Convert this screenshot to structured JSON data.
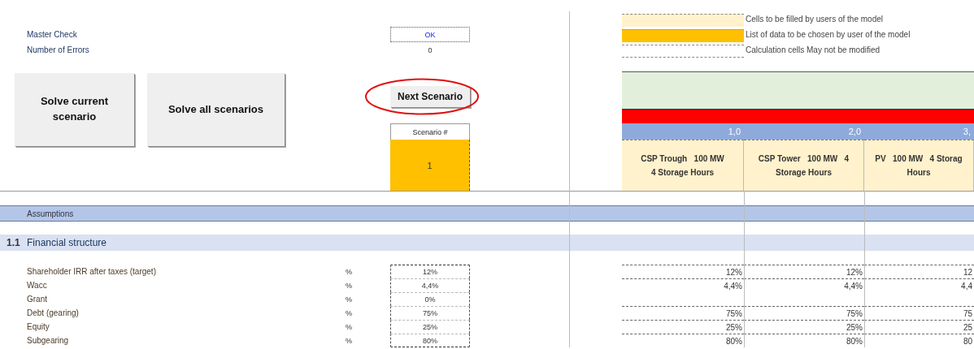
{
  "checks": [
    {
      "label": "Master Check",
      "value": "OK",
      "kind": "status"
    },
    {
      "label": "Number of Errors",
      "value": "0",
      "kind": "count"
    }
  ],
  "legend": [
    {
      "kind": "input",
      "text": "Cells to be filled by users of the model"
    },
    {
      "kind": "list",
      "text": "List of data to be chosen by user of the model"
    },
    {
      "kind": "calc",
      "text": "Calculation cells  May not be modified"
    }
  ],
  "buttons": [
    "Solve current scenario",
    "Solve all scenarios"
  ],
  "next_button": {
    "label": "Next Scenario",
    "highlighted": true
  },
  "scenario_selector": {
    "label": "Scenario #",
    "value": "1"
  },
  "scenarios": [
    {
      "number": "1,0",
      "name_lines": [
        "CSP Trough   100 MW",
        "4 Storage Hours"
      ]
    },
    {
      "number": "2,0",
      "name_lines": [
        "CSP Tower   100 MW   4",
        "Storage Hours"
      ]
    },
    {
      "number": "3,",
      "name_lines": [
        "PV   100 MW   4 Storag",
        "Hours"
      ]
    }
  ],
  "section": {
    "title": "Assumptions"
  },
  "subsection": {
    "number": "1.1",
    "title": "Financial structure"
  },
  "rows": [
    {
      "label": "Shareholder IRR after taxes (target)",
      "unit": "%",
      "base": "12%",
      "values": [
        "12%",
        "12%",
        "12"
      ]
    },
    {
      "label": "Wacc",
      "unit": "%",
      "base": "4,4%",
      "values": [
        "4,4%",
        "4,4%",
        "4,4"
      ]
    },
    {
      "label": "Grant",
      "unit": "%",
      "base": "0%"
    },
    {
      "label": "Debt (gearing)",
      "unit": "%",
      "base": "75%",
      "values": [
        "75%",
        "75%",
        "75"
      ]
    },
    {
      "label": "Equity",
      "unit": "%",
      "base": "25%",
      "values": [
        "25%",
        "25%",
        "25"
      ]
    },
    {
      "label": "Subgearing",
      "unit": "%",
      "base": "80%",
      "values": [
        "80%",
        "80%",
        "80"
      ]
    }
  ]
}
